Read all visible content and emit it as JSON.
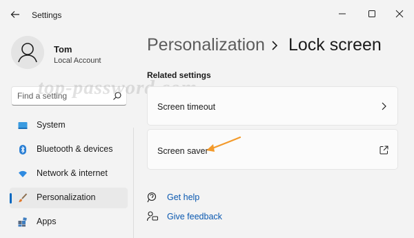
{
  "window": {
    "title": "Settings",
    "controls": {
      "minimize": "minimize-icon",
      "maximize": "maximize-icon",
      "close": "close-icon"
    }
  },
  "user": {
    "name": "Tom",
    "account_type": "Local Account"
  },
  "search": {
    "placeholder": "Find a setting"
  },
  "watermark": "top-password.com",
  "sidebar": {
    "items": [
      {
        "label": "System",
        "icon": "monitor-icon",
        "active": false
      },
      {
        "label": "Bluetooth & devices",
        "icon": "bluetooth-icon",
        "active": false
      },
      {
        "label": "Network & internet",
        "icon": "wifi-icon",
        "active": false
      },
      {
        "label": "Personalization",
        "icon": "brush-icon",
        "active": true
      },
      {
        "label": "Apps",
        "icon": "apps-icon",
        "active": false
      }
    ]
  },
  "breadcrumb": {
    "parent": "Personalization",
    "current": "Lock screen"
  },
  "related": {
    "heading": "Related settings",
    "items": [
      {
        "label": "Screen timeout",
        "icon": "chevron-right-icon"
      },
      {
        "label": "Screen saver",
        "icon": "external-link-icon"
      }
    ]
  },
  "help": {
    "get_help": "Get help",
    "give_feedback": "Give feedback"
  },
  "colors": {
    "accent": "#0067c0",
    "link": "#0a58b0",
    "annotation_arrow": "#f39a2b",
    "background": "#f3f3f3"
  }
}
